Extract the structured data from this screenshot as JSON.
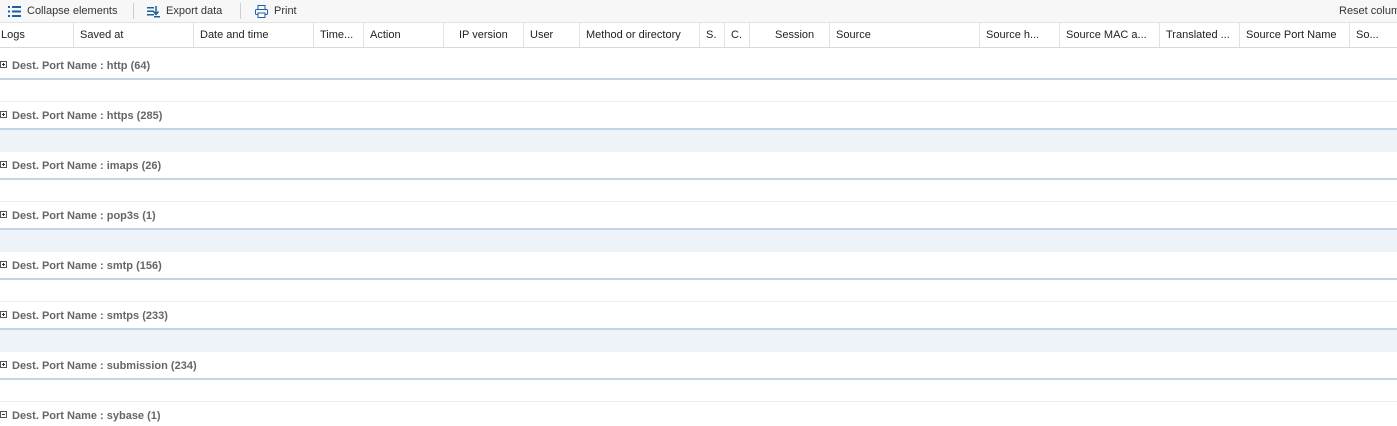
{
  "toolbar": {
    "collapse_label": "Collapse elements",
    "export_label": "Export data",
    "print_label": "Print",
    "reset_label": "Reset columns"
  },
  "columns": [
    "Logs",
    "Saved at",
    "Date and time",
    "Time...",
    "Action",
    "IP version",
    "User",
    "Method or directory",
    "S.",
    "C.",
    "Session",
    "Source",
    "Source h...",
    "Source MAC a...",
    "Translated ...",
    "Source Port Name",
    "So..."
  ],
  "groups": [
    {
      "label": "Dest. Port Name : http (64)",
      "expanded": false
    },
    {
      "label": "Dest. Port Name : https (285)",
      "expanded": false
    },
    {
      "label": "Dest. Port Name : imaps (26)",
      "expanded": false
    },
    {
      "label": "Dest. Port Name : pop3s (1)",
      "expanded": false
    },
    {
      "label": "Dest. Port Name : smtp (156)",
      "expanded": false
    },
    {
      "label": "Dest. Port Name : smtps (233)",
      "expanded": false
    },
    {
      "label": "Dest. Port Name : submission (234)",
      "expanded": false
    },
    {
      "label": "Dest. Port Name : sybase (1)",
      "expanded": true
    }
  ],
  "icons": {
    "collapse": "list-collapse-icon",
    "export": "export-icon",
    "print": "printer-icon"
  },
  "colors": {
    "accent": "#1f5f9e",
    "group_border": "#c5d4e3",
    "alt_row": "#eef3fa"
  }
}
